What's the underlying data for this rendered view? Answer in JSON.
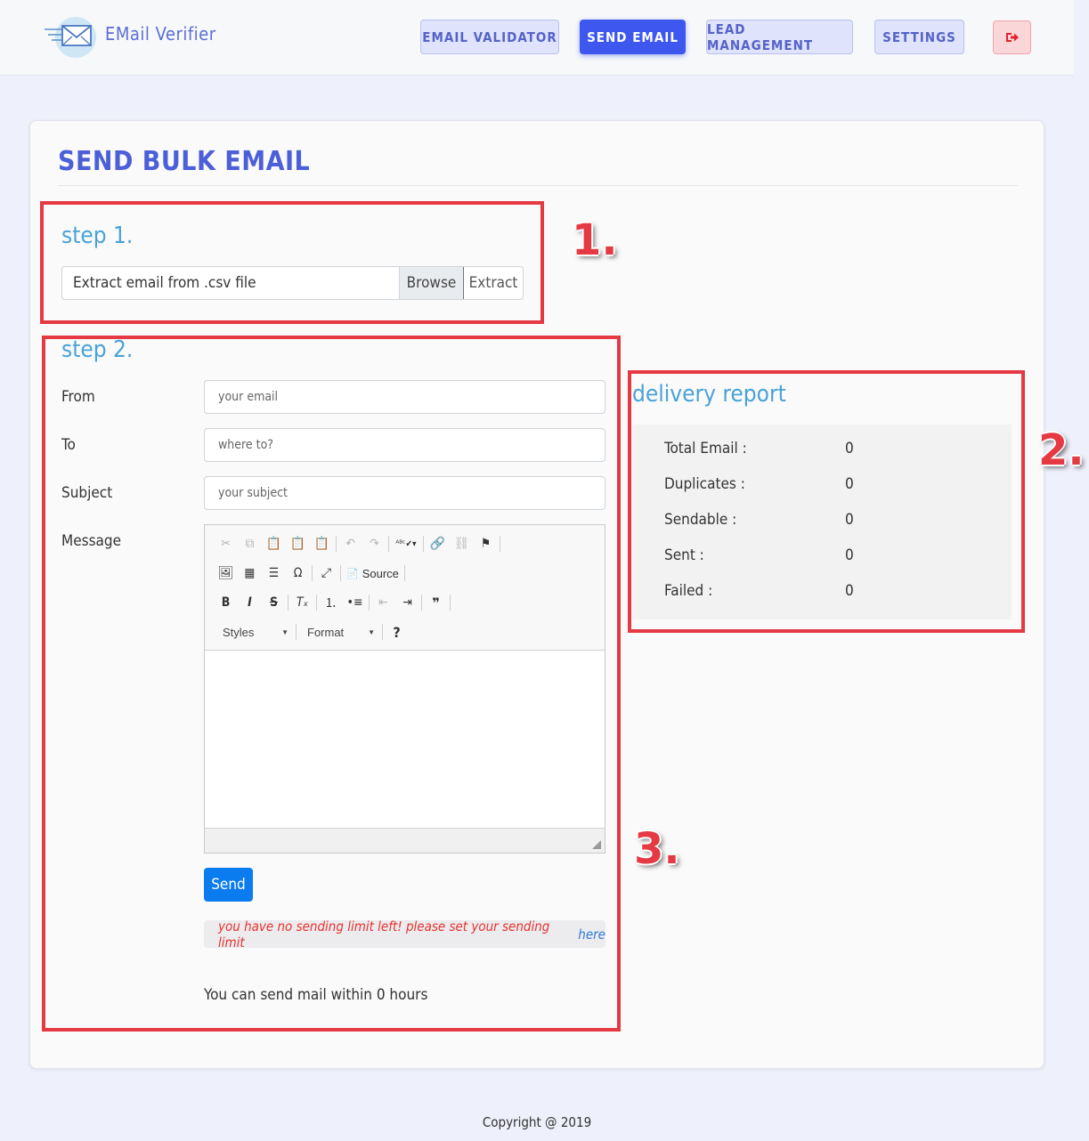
{
  "app": {
    "name": "EMail Verifier"
  },
  "nav": {
    "items": [
      "EMAIL VALIDATOR",
      "SEND EMAIL",
      "LEAD MANAGEMENT",
      "SETTINGS"
    ],
    "active": "SEND EMAIL"
  },
  "page": {
    "title": "SEND BULK EMAIL"
  },
  "step1": {
    "label": "step 1.",
    "file_placeholder": "Extract email from .csv file",
    "browse_label": "Browse",
    "extract_label": "Extract"
  },
  "step2": {
    "label": "step 2.",
    "from": {
      "label": "From",
      "placeholder": "your email"
    },
    "to": {
      "label": "To",
      "placeholder": "where to?"
    },
    "subject": {
      "label": "Subject",
      "placeholder": "your subject"
    },
    "message": {
      "label": "Message"
    },
    "editor": {
      "source_label": "Source",
      "styles_label": "Styles",
      "format_label": "Format"
    },
    "send_label": "Send",
    "alert_text": "you have no sending limit left! please set your sending limit",
    "alert_link": "here",
    "within_text": "You can send mail within 0 hours"
  },
  "report": {
    "title": "delivery report",
    "rows": [
      {
        "label": "Total Email :",
        "value": "0"
      },
      {
        "label": "Duplicates :",
        "value": "0"
      },
      {
        "label": "Sendable :",
        "value": "0"
      },
      {
        "label": "Sent :",
        "value": "0"
      },
      {
        "label": "Failed :",
        "value": "0"
      }
    ]
  },
  "annotations": [
    "1.",
    "2.",
    "3."
  ],
  "footer": {
    "copyright": "Copyright @ 2019"
  },
  "colors": {
    "primary": "#3d57ef",
    "accent_blue": "#4aa3d6",
    "annotation_red": "#e53a43",
    "send_button": "#0a7cf0"
  }
}
